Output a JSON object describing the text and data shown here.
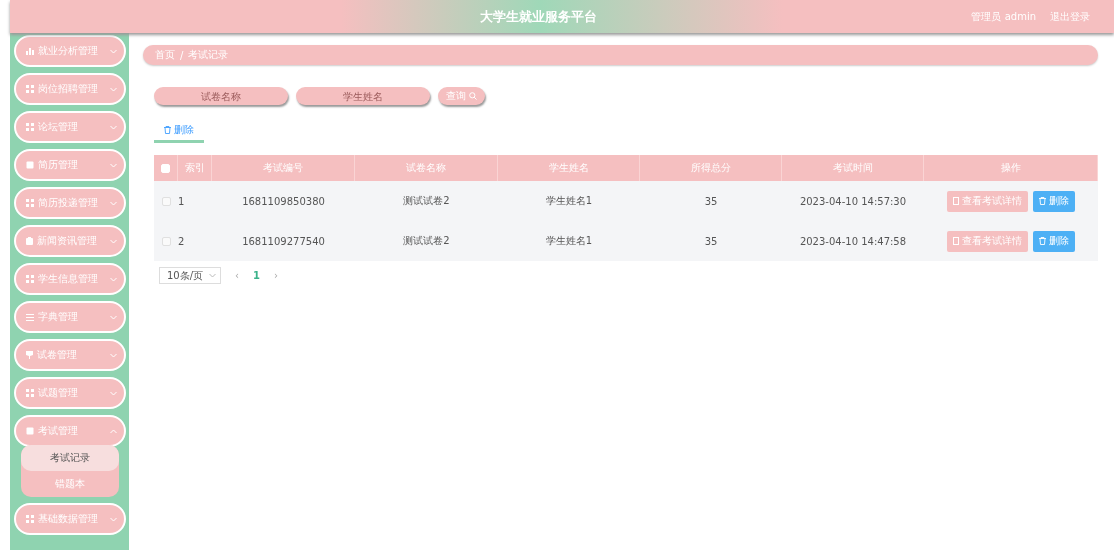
{
  "header": {
    "title": "大学生就业服务平台",
    "user": "管理员 admin",
    "logout": "退出登录"
  },
  "sidebar": {
    "items": [
      {
        "label": "就业分析管理",
        "kind": "chart",
        "expanded": false
      },
      {
        "label": "岗位招聘管理",
        "kind": "grid",
        "expanded": false
      },
      {
        "label": "论坛管理",
        "kind": "grid",
        "expanded": false
      },
      {
        "label": "简历管理",
        "kind": "doc",
        "expanded": false
      },
      {
        "label": "简历投递管理",
        "kind": "grid",
        "expanded": false
      },
      {
        "label": "新闻资讯管理",
        "kind": "clip",
        "expanded": false
      },
      {
        "label": "学生信息管理",
        "kind": "grid",
        "expanded": false
      },
      {
        "label": "字典管理",
        "kind": "list",
        "expanded": false
      },
      {
        "label": "试卷管理",
        "kind": "cup",
        "expanded": false
      },
      {
        "label": "试题管理",
        "kind": "grid",
        "expanded": false
      },
      {
        "label": "考试管理",
        "kind": "doc",
        "expanded": true,
        "children": [
          {
            "label": "考试记录",
            "selected": true
          },
          {
            "label": "错题本",
            "selected": false
          }
        ]
      },
      {
        "label": "基础数据管理",
        "kind": "grid",
        "expanded": false
      }
    ]
  },
  "breadcrumb": [
    "首页",
    "/",
    "考试记录"
  ],
  "search": {
    "fields": [
      {
        "placeholder": "试卷名称"
      },
      {
        "placeholder": "学生姓名"
      }
    ],
    "button": "查询"
  },
  "tabs": [
    {
      "label": "删除",
      "selected": true
    }
  ],
  "table": {
    "all_checked": false,
    "columns": [
      "索引",
      "考试编号",
      "试卷名称",
      "学生姓名",
      "所得总分",
      "考试时间",
      "操作"
    ],
    "rows": [
      {
        "checked": false,
        "index": "1",
        "code": "1681109850380",
        "paper": "测试试卷2",
        "student": "学生姓名1",
        "score": "35",
        "time": "2023-04-10 14:57:30",
        "actions": [
          "查看考试详情",
          "删除"
        ]
      },
      {
        "checked": false,
        "index": "2",
        "code": "1681109277540",
        "paper": "测试试卷2",
        "student": "学生姓名1",
        "score": "35",
        "time": "2023-04-10 14:47:58",
        "actions": [
          "查看考试详情",
          "删除"
        ]
      }
    ]
  },
  "pagination": {
    "page_size": "10条/页",
    "prev": "‹",
    "pages": [
      {
        "label": "1",
        "selected": true
      }
    ],
    "next": "›"
  }
}
